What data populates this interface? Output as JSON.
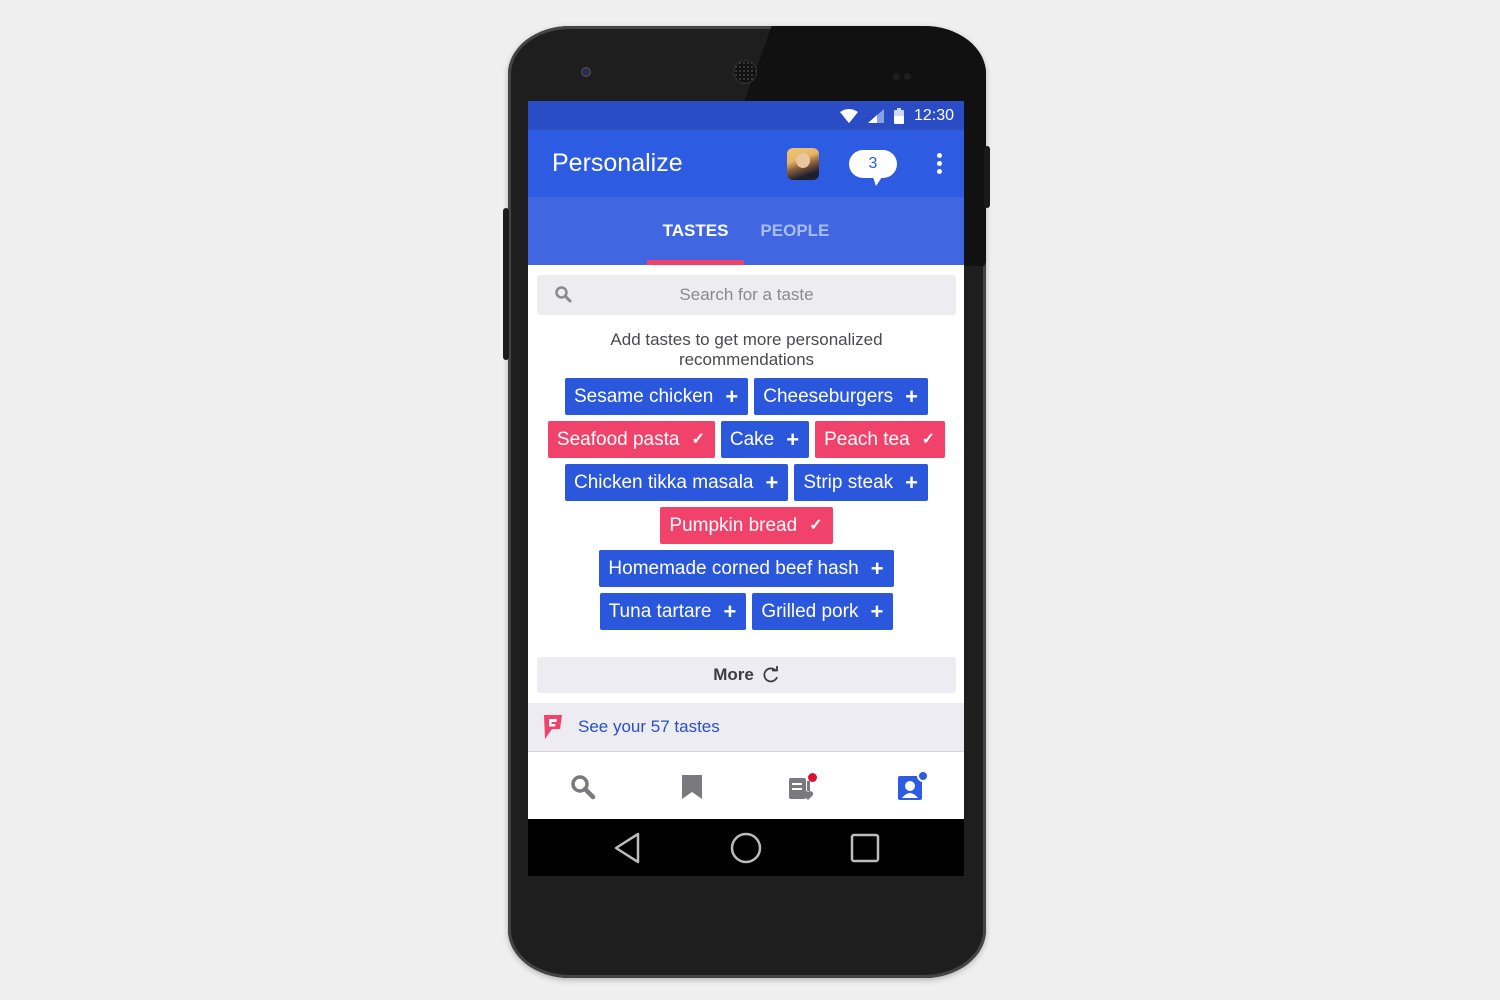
{
  "statusbar": {
    "time": "12:30",
    "icons": [
      "wifi-icon",
      "signal-icon",
      "battery-icon"
    ]
  },
  "appbar": {
    "title": "Personalize",
    "notification_count": "3",
    "icons": [
      "avatar",
      "chat-bubble-icon",
      "more-vert-icon"
    ]
  },
  "tabs": [
    {
      "label": "TASTES",
      "active": true
    },
    {
      "label": "PEOPLE",
      "active": false
    }
  ],
  "search": {
    "placeholder": "Search for a taste",
    "value": ""
  },
  "hint": "Add tastes to get more personalized recommendations",
  "tastes": {
    "rows": [
      [
        {
          "label": "Sesame chicken",
          "selected": false
        },
        {
          "label": "Cheeseburgers",
          "selected": false
        }
      ],
      [
        {
          "label": "Seafood pasta",
          "selected": true
        },
        {
          "label": "Cake",
          "selected": false
        },
        {
          "label": "Peach tea",
          "selected": true
        }
      ],
      [
        {
          "label": "Chicken tikka masala",
          "selected": false
        },
        {
          "label": "Strip steak",
          "selected": false
        }
      ],
      [
        {
          "label": "Pumpkin bread",
          "selected": true
        }
      ],
      [
        {
          "label": "Homemade corned beef hash",
          "selected": false
        }
      ],
      [
        {
          "label": "Tuna tartare",
          "selected": false
        },
        {
          "label": "Grilled pork",
          "selected": false
        }
      ]
    ],
    "add_symbol": "+",
    "selected_symbol": "✓"
  },
  "more_button": {
    "label": "More"
  },
  "see_tastes": {
    "label": "See your 57 tastes"
  },
  "bottom_nav": [
    {
      "name": "search",
      "active": false,
      "badge": null
    },
    {
      "name": "saved",
      "active": false,
      "badge": null
    },
    {
      "name": "lists",
      "active": false,
      "badge": "#e0102e"
    },
    {
      "name": "profile",
      "active": true,
      "badge": "#2d5be1"
    }
  ],
  "colors": {
    "primary": "#2d5be1",
    "tab_bar": "#4067e1",
    "accent": "#f0426a",
    "chip_add": "#2a57db"
  }
}
